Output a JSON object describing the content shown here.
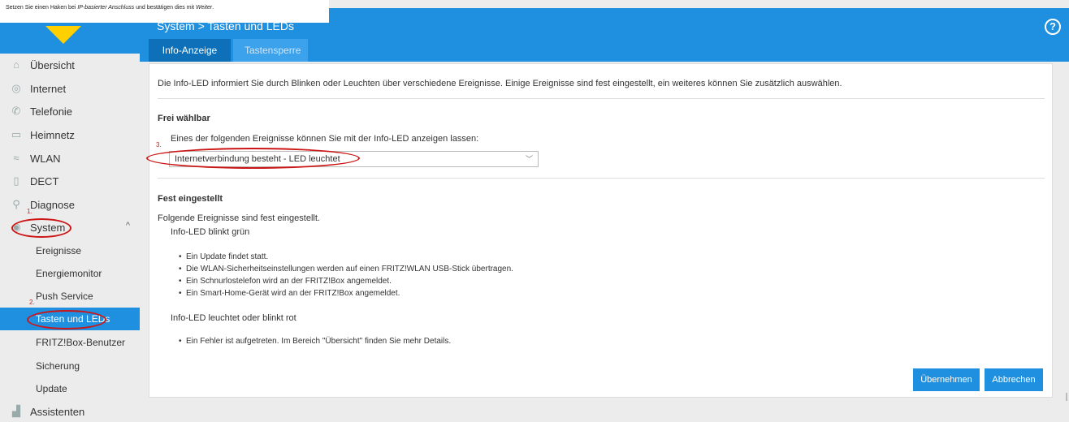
{
  "instruction": {
    "prefix": "Setzen Sie einen Haken bei ",
    "emph1": "IP-basierter Anschluss",
    "middle": " und bestätigen dies mit ",
    "emph2": "Weiter",
    "suffix": "."
  },
  "header": {
    "breadcrumb": "System > Tasten und LEDs",
    "help_symbol": "?"
  },
  "tabs": [
    {
      "label": "Info-Anzeige",
      "active": true
    },
    {
      "label": "Tastensperre",
      "active": false
    }
  ],
  "sidebar": {
    "items": [
      {
        "label": "Übersicht",
        "icon": "home-icon"
      },
      {
        "label": "Internet",
        "icon": "globe-icon"
      },
      {
        "label": "Telefonie",
        "icon": "phone-icon"
      },
      {
        "label": "Heimnetz",
        "icon": "network-icon"
      },
      {
        "label": "WLAN",
        "icon": "wifi-icon"
      },
      {
        "label": "DECT",
        "icon": "dect-icon"
      },
      {
        "label": "Diagnose",
        "icon": "search-icon"
      },
      {
        "label": "System",
        "icon": "gear-icon",
        "expanded": true
      }
    ],
    "system_children": [
      {
        "label": "Ereignisse"
      },
      {
        "label": "Energiemonitor"
      },
      {
        "label": "Push Service"
      },
      {
        "label": "Tasten und LEDs",
        "active": true
      },
      {
        "label": "FRITZ!Box-Benutzer"
      },
      {
        "label": "Sicherung"
      },
      {
        "label": "Update"
      }
    ],
    "assistenten": {
      "label": "Assistenten",
      "icon": "wizard-icon"
    }
  },
  "annotations": {
    "one": "1.",
    "two": "2.",
    "three": "3."
  },
  "main": {
    "intro": "Die Info-LED informiert Sie durch Blinken oder Leuchten über verschiedene Ereignisse. Einige Ereignisse sind fest eingestellt, ein weiteres können Sie zusätzlich auswählen.",
    "frei": {
      "title": "Frei wählbar",
      "label": "Eines der folgenden Ereignisse können Sie mit der Info-LED anzeigen lassen:",
      "selected": "Internetverbindung besteht - LED leuchtet"
    },
    "fest": {
      "title": "Fest eingestellt",
      "intro": "Folgende Ereignisse sind fest eingestellt.",
      "green_title": "Info-LED blinkt grün",
      "green_items": [
        "Ein Update findet statt.",
        "Die WLAN-Sicherheitseinstellungen werden auf einen FRITZ!WLAN USB-Stick übertragen.",
        "Ein Schnurlostelefon wird an der FRITZ!Box angemeldet.",
        "Ein Smart-Home-Gerät wird an der FRITZ!Box angemeldet."
      ],
      "red_title": "Info-LED leuchtet oder blinkt rot",
      "red_items": [
        "Ein Fehler ist aufgetreten. Im Bereich \"Übersicht\" finden Sie mehr Details."
      ]
    },
    "buttons": {
      "apply": "Übernehmen",
      "cancel": "Abbrechen"
    }
  }
}
